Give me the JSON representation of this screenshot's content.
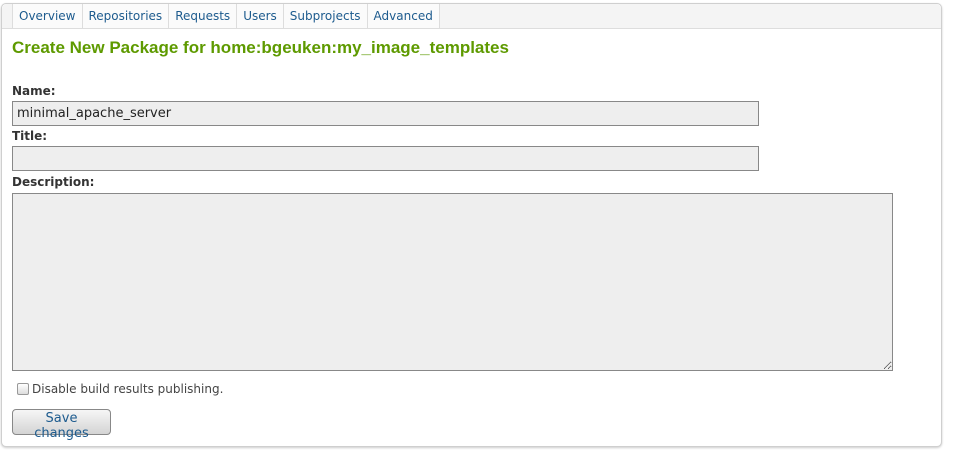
{
  "tabs": [
    "Overview",
    "Repositories",
    "Requests",
    "Users",
    "Subprojects",
    "Advanced"
  ],
  "title": "Create New Package for home:bgeuken:my_image_templates",
  "form": {
    "name_label": "Name:",
    "name_value": "minimal_apache_server",
    "title_label": "Title:",
    "title_value": "",
    "description_label": "Description:",
    "description_value": "",
    "disable_publish_label": "Disable build results publishing.",
    "disable_publish_checked": false,
    "save_label": "Save changes"
  }
}
